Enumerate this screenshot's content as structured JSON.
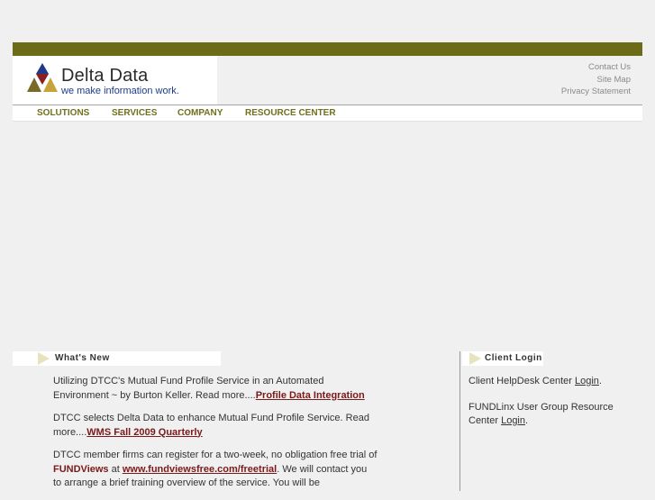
{
  "brand": {
    "name": "Delta Data",
    "tagline": "we make information work."
  },
  "utility_links": [
    "Contact Us",
    "Site Map",
    "Privacy Statement"
  ],
  "nav": [
    "SOLUTIONS",
    "SERVICES",
    "COMPANY",
    "RESOURCE CENTER"
  ],
  "whats_new": {
    "heading": "What's New",
    "item1": {
      "text": "Utilizing DTCC's Mutual Fund Profile Service in an Automated Environment ~ by Burton Keller. Read more....",
      "link": "Profile Data Integration"
    },
    "item2": {
      "text": "DTCC selects Delta Data to enhance Mutual Fund Profile Service. Read more....",
      "link": "WMS Fall 2009 Quarterly "
    },
    "item3": {
      "text_a": "DTCC member firms can register for a two-week, no obligation free trial of ",
      "brand": "FUNDViews",
      "text_b": " at ",
      "link": "www.fundviewsfree.com/freetrial",
      "text_c": ". We will contact you to arrange a brief training overview of the service. You will be"
    }
  },
  "client_login": {
    "heading": "Client Login",
    "item1": {
      "text": "Client HelpDesk Center ",
      "link": "Login",
      "end": "."
    },
    "item2": {
      "text": "FUNDLinx User Group Resource Center ",
      "link": "Login",
      "end": "."
    }
  },
  "colors": {
    "topbar": "#6b6b18",
    "nav_text": "#70701f",
    "link": "#7a1a1a",
    "arrow": "#e6e3bd"
  }
}
